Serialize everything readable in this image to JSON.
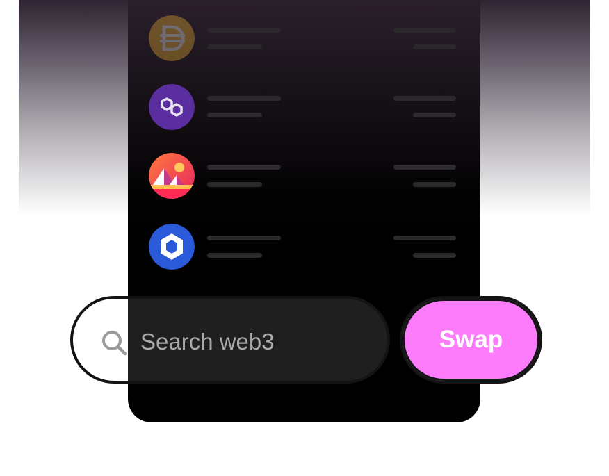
{
  "search": {
    "placeholder": "Search web3"
  },
  "swap": {
    "label": "Swap"
  },
  "tokens": [
    {
      "icon": "dai-icon",
      "color": "#f4b731"
    },
    {
      "icon": "polygon-icon",
      "color": "#7b3fe4"
    },
    {
      "icon": "decentraland-icon",
      "color": "#ff2d55"
    },
    {
      "icon": "chainlink-icon",
      "color": "#2a5ada"
    }
  ],
  "colors": {
    "accent": "#fb7bfb",
    "phone_background": "#000000",
    "skeleton_bar": "#2c2a2d"
  }
}
